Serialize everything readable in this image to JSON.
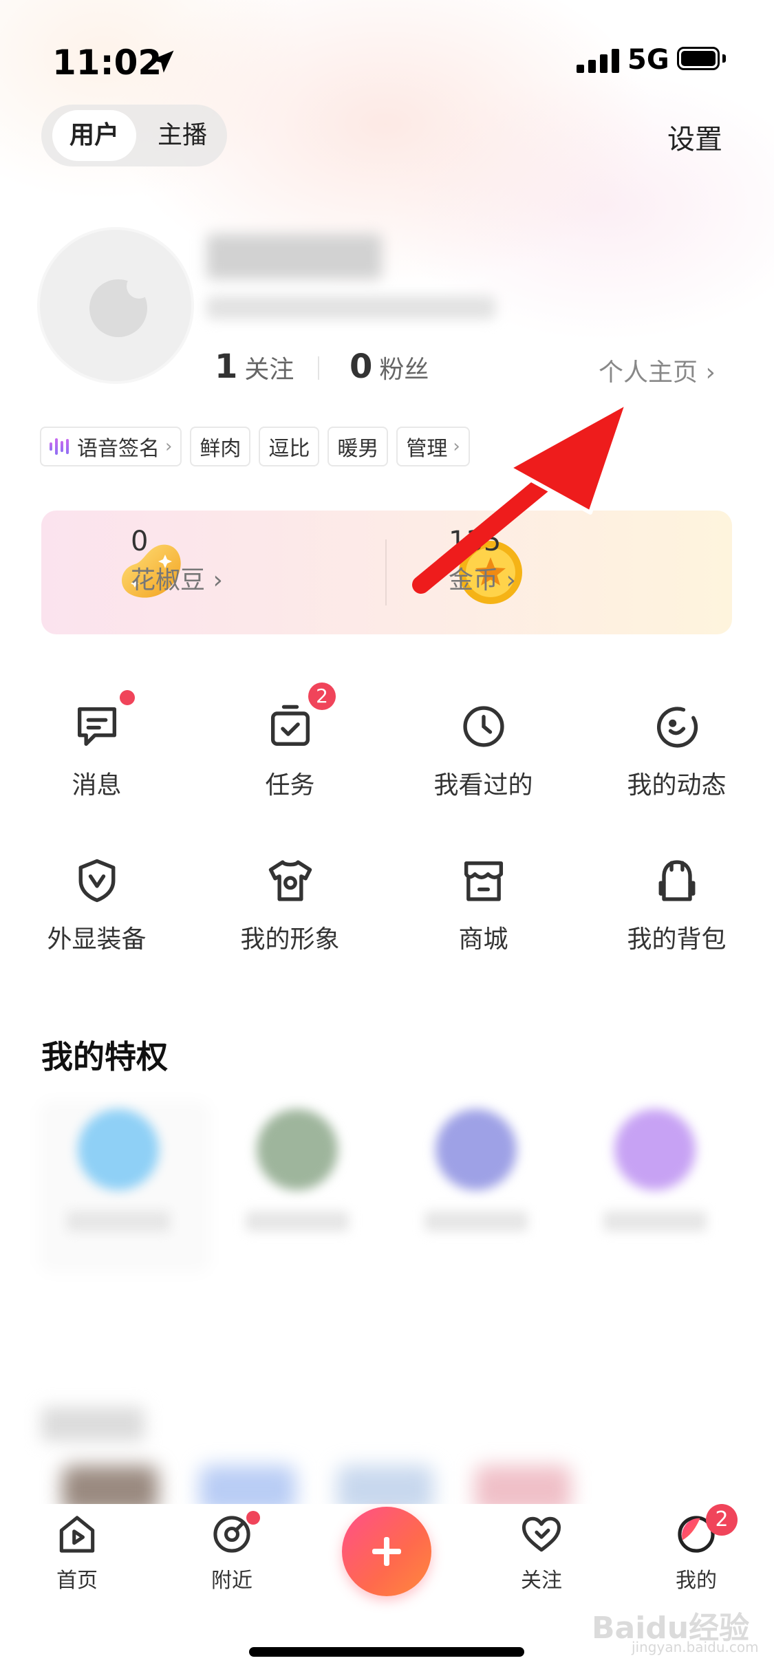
{
  "status_bar": {
    "time": "11:02",
    "network": "5G"
  },
  "header": {
    "role_tabs": [
      "用户",
      "主播"
    ],
    "settings_label": "设置"
  },
  "profile": {
    "following_count": "1",
    "following_label": "关注",
    "followers_count": "0",
    "followers_label": "粉丝",
    "homepage_link": "个人主页 ›"
  },
  "tags": [
    "语音签名",
    "鲜肉",
    "逗比",
    "暖男",
    "管理"
  ],
  "wallet": {
    "beans_value": "0",
    "beans_label": "花椒豆 ›",
    "coins_value": "135",
    "coins_label": "金币 ›"
  },
  "grid": [
    {
      "label": "消息",
      "icon": "message-icon",
      "dot": true
    },
    {
      "label": "任务",
      "icon": "task-icon",
      "badge": "2"
    },
    {
      "label": "我看过的",
      "icon": "history-icon"
    },
    {
      "label": "我的动态",
      "icon": "moments-icon"
    },
    {
      "label": "外显装备",
      "icon": "shield-icon"
    },
    {
      "label": "我的形象",
      "icon": "outfit-icon"
    },
    {
      "label": "商城",
      "icon": "store-icon"
    },
    {
      "label": "我的背包",
      "icon": "backpack-icon"
    }
  ],
  "privileges_title": "我的特权",
  "tabbar": {
    "items": [
      {
        "label": "首页",
        "icon": "home-play-icon"
      },
      {
        "label": "附近",
        "icon": "nearby-icon"
      },
      {
        "label": "关注",
        "icon": "heart-icon"
      },
      {
        "label": "我的",
        "icon": "profile-icon"
      }
    ],
    "profile_badge": "2"
  },
  "watermark": {
    "brand": "Baidu经验",
    "url": "jingyan.baidu.com"
  },
  "colors": {
    "accent": "#f0445a",
    "plus_gradient_start": "#ff4f8a",
    "plus_gradient_end": "#ff8a3c",
    "annotation_arrow": "#ee1c1c"
  }
}
